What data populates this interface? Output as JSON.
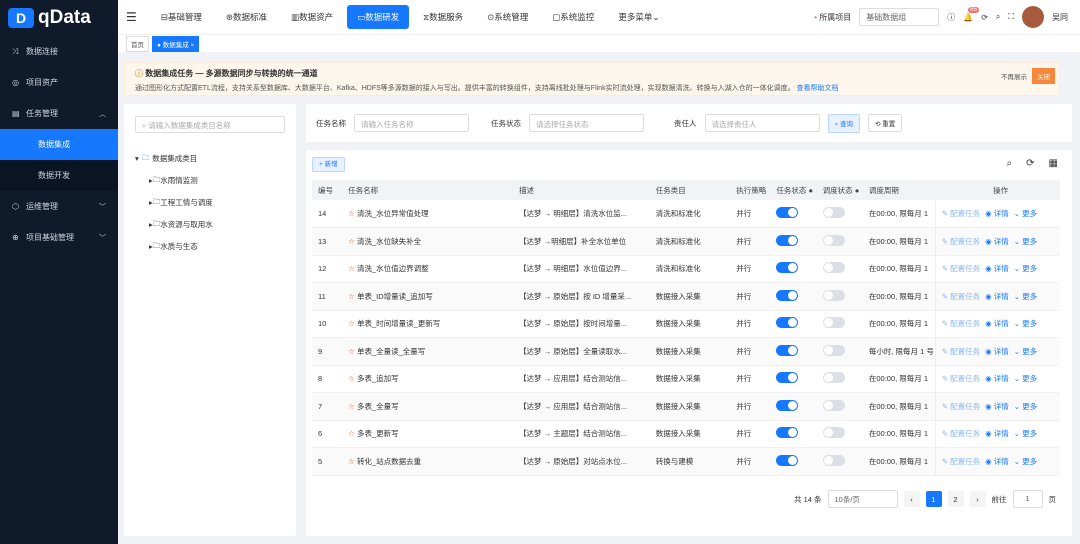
{
  "app": {
    "name": "qData"
  },
  "sidebar": {
    "items": [
      {
        "label": "数据连接",
        "icon": "shuffle-icon"
      },
      {
        "label": "项目资产",
        "icon": "target-icon"
      },
      {
        "label": "任务管理",
        "icon": "grid-icon",
        "expanded": true,
        "children": [
          {
            "label": "数据集成",
            "active": true
          },
          {
            "label": "数据开发"
          }
        ]
      },
      {
        "label": "运维管理",
        "icon": "box-icon"
      },
      {
        "label": "项目基础管理",
        "icon": "globe-icon"
      }
    ]
  },
  "topnav": {
    "items": [
      "基础管理",
      "数据标准",
      "数据资产",
      "数据研发",
      "数据服务",
      "系统管理",
      "系统监控",
      "更多菜单"
    ],
    "active": "数据研发",
    "project_label": "所属项目",
    "project_value": "基础数据组",
    "badge": "65",
    "user": "吴同"
  },
  "tabs": [
    "首页",
    "数据集成"
  ],
  "notice": {
    "title": "数据集成任务 — 多源数据同步与转换的统一通道",
    "desc": "通过图形化方式配置ETL流程，支持关系型数据库、大数据平台、Kafka、HDFS等多源数据的接入与写出。提供丰富的转换组件，支持离线批处理与Flink实时流处理，实现数据清洗、转换与入湖入仓的一体化调度。",
    "link": "查看帮助文档",
    "no_more": "不再展示",
    "close": "关闭"
  },
  "tree": {
    "placeholder": "请输入数据集成类目名称",
    "root": "数据集成类目",
    "children": [
      "水雨情监测",
      "工程工情与调度",
      "水资源与取用水",
      "水质与生态"
    ]
  },
  "filter": {
    "name_label": "任务名称",
    "name_ph": "请输入任务名称",
    "status_label": "任务状态",
    "status_ph": "请选择任务状态",
    "owner_label": "责任人",
    "owner_ph": "请选择责任人",
    "search": "查询",
    "reset": "重置"
  },
  "toolbar": {
    "add": "+ 新增"
  },
  "table": {
    "headers": [
      "编号",
      "任务名称",
      "描述",
      "任务类目",
      "执行策略",
      "任务状态",
      "调度状态",
      "调度周期",
      "操作"
    ],
    "ops": [
      "配置任务",
      "详情",
      "更多"
    ],
    "rows": [
      {
        "id": "14",
        "name": "清洗_水位异常值处理",
        "desc": "【达梦 → 明细层】清洗水位监...",
        "cat": "清洗和标准化",
        "policy": "并行",
        "status": true,
        "sched": false,
        "cycle": "在00:00, 限每月 1"
      },
      {
        "id": "13",
        "name": "清洗_水位缺失补全",
        "desc": "【达梦 →明细层】补全水位单位",
        "cat": "清洗和标准化",
        "policy": "并行",
        "status": true,
        "sched": false,
        "cycle": "在00:00, 限每月 1"
      },
      {
        "id": "12",
        "name": "清洗_水位值边界调整",
        "desc": "【达梦 → 明细层】水位值边界...",
        "cat": "清洗和标准化",
        "policy": "并行",
        "status": true,
        "sched": false,
        "cycle": "在00:00, 限每月 1"
      },
      {
        "id": "11",
        "name": "单表_ID增量读_追加写",
        "desc": "【达梦 → 原始层】按 ID 增量采...",
        "cat": "数据接入采集",
        "policy": "并行",
        "status": true,
        "sched": false,
        "cycle": "在00:00, 限每月 1"
      },
      {
        "id": "10",
        "name": "单表_时间增量读_更新写",
        "desc": "【达梦 → 原始层】按时间增量...",
        "cat": "数据接入采集",
        "policy": "并行",
        "status": true,
        "sched": false,
        "cycle": "在00:00, 限每月 1"
      },
      {
        "id": "9",
        "name": "单表_全量读_全量写",
        "desc": "【达梦 → 原始层】全量读取水...",
        "cat": "数据接入采集",
        "policy": "并行",
        "status": true,
        "sched": false,
        "cycle": "每小时, 限每月 1 号"
      },
      {
        "id": "8",
        "name": "多表_追加写",
        "desc": "【达梦 → 应用层】结合测站信...",
        "cat": "数据接入采集",
        "policy": "并行",
        "status": true,
        "sched": false,
        "cycle": "在00:00, 限每月 1"
      },
      {
        "id": "7",
        "name": "多表_全量写",
        "desc": "【达梦 → 应用层】结合测站信...",
        "cat": "数据接入采集",
        "policy": "并行",
        "status": true,
        "sched": false,
        "cycle": "在00:00, 限每月 1"
      },
      {
        "id": "6",
        "name": "多表_更新写",
        "desc": "【达梦 → 主题层】结合测站信...",
        "cat": "数据接入采集",
        "policy": "并行",
        "status": true,
        "sched": false,
        "cycle": "在00:00, 限每月 1"
      },
      {
        "id": "5",
        "name": "转化_站点数据去重",
        "desc": "【达梦 → 原始层】对站点水位...",
        "cat": "转换与建模",
        "policy": "并行",
        "status": true,
        "sched": false,
        "cycle": "在00:00, 限每月 1"
      }
    ]
  },
  "pagination": {
    "total": "共 14 条",
    "page_size": "10条/页",
    "pages": [
      "1",
      "2"
    ],
    "current": "1",
    "goto_label": "前往",
    "goto_value": "1",
    "page_unit": "页"
  },
  "colors": {
    "primary": "#1677ff",
    "sidebar": "#0f1a2b",
    "warn": "#f5883a"
  }
}
